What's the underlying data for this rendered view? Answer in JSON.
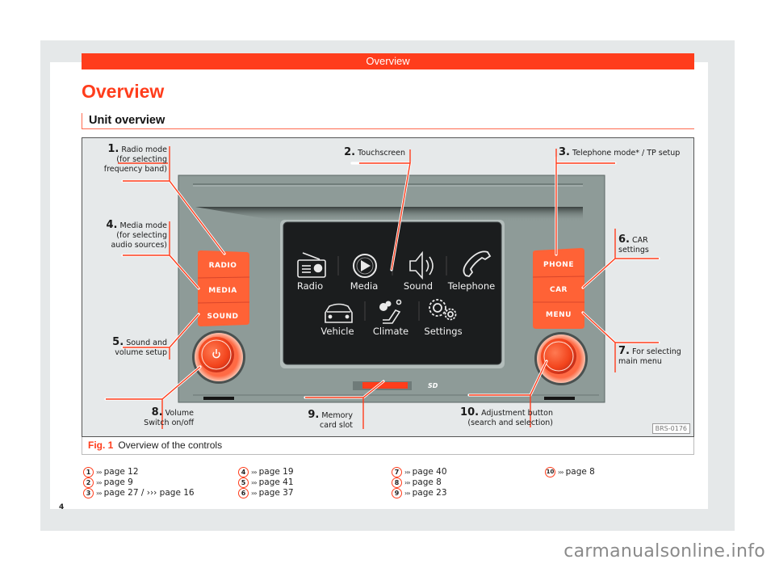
{
  "header": {
    "running_title": "Overview"
  },
  "page_title": "Overview",
  "section_title": "Unit overview",
  "figure": {
    "label": "Fig. 1",
    "caption": "Overview of the controls",
    "code": "BRS-0176",
    "callouts": [
      {
        "num": "1.",
        "text": "Radio mode (for selecting frequency band)",
        "lines": [
          "Radio mode",
          "(for selecting",
          "frequency band)"
        ]
      },
      {
        "num": "2.",
        "text": "Touchscreen",
        "lines": [
          "Touchscreen"
        ]
      },
      {
        "num": "3.",
        "text": "Telephone mode* / TP setup",
        "lines": [
          "Telephone mode* / TP setup"
        ]
      },
      {
        "num": "4.",
        "text": "Media mode (for selecting audio sources)",
        "lines": [
          "Media mode",
          "(for selecting",
          "audio sources)"
        ]
      },
      {
        "num": "5.",
        "text": "Sound and volume setup",
        "lines": [
          "Sound and",
          "volume setup"
        ]
      },
      {
        "num": "6.",
        "text": "CAR settings",
        "lines": [
          "CAR",
          "settings"
        ]
      },
      {
        "num": "7.",
        "text": "For selecting main menu",
        "lines": [
          "For selecting",
          "main menu"
        ]
      },
      {
        "num": "8.",
        "text": "Volume Switch on/off",
        "lines": [
          "Volume",
          "Switch on/off"
        ]
      },
      {
        "num": "9.",
        "text": "Memory card slot",
        "lines": [
          "Memory",
          "card slot"
        ]
      },
      {
        "num": "10.",
        "text": "Adjustment button (search and selection)",
        "lines": [
          "Adjustment button",
          "(search and selection)"
        ]
      }
    ],
    "left_buttons": [
      "RADIO",
      "MEDIA",
      "SOUND"
    ],
    "right_buttons": [
      "PHONE",
      "CAR",
      "MENU"
    ],
    "screen_row1": [
      {
        "label": "Radio",
        "icon": "radio-icon"
      },
      {
        "label": "Media",
        "icon": "play-icon"
      },
      {
        "label": "Sound",
        "icon": "speaker-icon"
      },
      {
        "label": "Telephone",
        "icon": "phone-handset-icon"
      }
    ],
    "screen_row2": [
      {
        "label": "Vehicle",
        "icon": "car-icon"
      },
      {
        "label": "Climate",
        "icon": "fan-seat-icon"
      },
      {
        "label": "Settings",
        "icon": "gears-icon"
      }
    ],
    "sd_label": "SD",
    "colors": {
      "accent": "#ff3d1c",
      "button": "#ff6236",
      "device": "#8e9b98",
      "screen": "#1b1d1e"
    }
  },
  "references": [
    {
      "num": "1",
      "text": "page 12"
    },
    {
      "num": "2",
      "text": "page 9"
    },
    {
      "num": "3",
      "text": "page 27 / ››› page 16"
    },
    {
      "num": "4",
      "text": "page 19"
    },
    {
      "num": "5",
      "text": "page 41"
    },
    {
      "num": "6",
      "text": "page 37"
    },
    {
      "num": "7",
      "text": "page 40"
    },
    {
      "num": "8",
      "text": "page 8"
    },
    {
      "num": "9",
      "text": "page 23"
    },
    {
      "num": "10",
      "text": "page 8"
    }
  ],
  "ref_arrow": "›››",
  "page_number": "4",
  "watermark": "carmanualsonline.info"
}
